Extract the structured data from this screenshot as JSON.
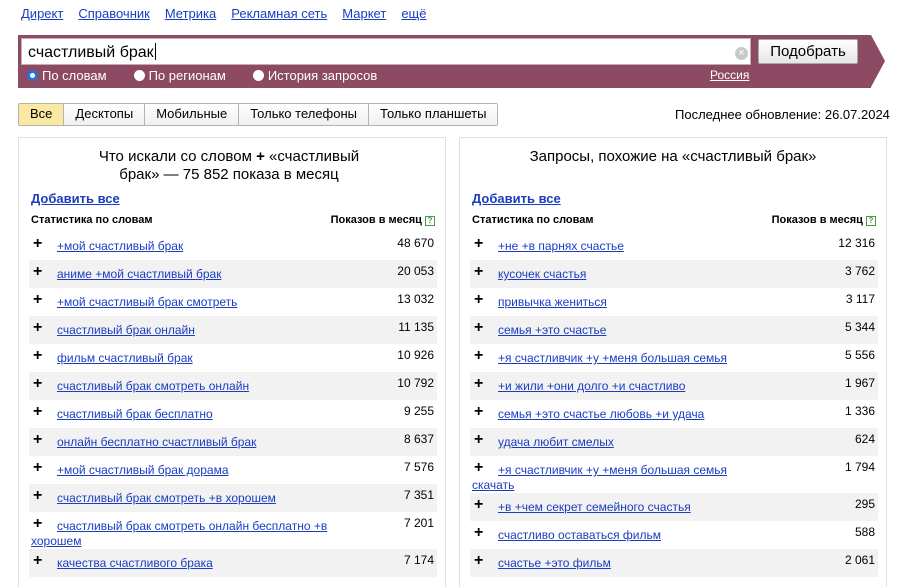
{
  "nav": [
    "Директ",
    "Справочник",
    "Метрика",
    "Рекламная сеть",
    "Маркет",
    "ещё"
  ],
  "search": {
    "query": "счастливый брак",
    "clear_glyph": "×",
    "button": "Подобрать",
    "radios": [
      "По словам",
      "По регионам",
      "История запросов"
    ],
    "region": "Россия"
  },
  "tabs": [
    "Все",
    "Десктопы",
    "Мобильные",
    "Только телефоны",
    "Только планшеты"
  ],
  "updated": "Последнее обновление: 26.07.2024",
  "left": {
    "title_line1": "Что искали со словом",
    "title_plus": "+",
    "title_rest": "«счастливый брак» — 75 852 показа в месяц",
    "add_all": "Добавить все",
    "col_phrase": "Статистика по словам",
    "col_count": "Показов в месяц",
    "rows": [
      {
        "phrase": "+мой счастливый брак",
        "count": "48 670"
      },
      {
        "phrase": "аниме +мой счастливый брак",
        "count": "20 053"
      },
      {
        "phrase": "+мой счастливый брак смотреть",
        "count": "13 032"
      },
      {
        "phrase": "счастливый брак онлайн",
        "count": "11 135"
      },
      {
        "phrase": "фильм счастливый брак",
        "count": "10 926"
      },
      {
        "phrase": "счастливый брак смотреть онлайн",
        "count": "10 792"
      },
      {
        "phrase": "счастливый брак бесплатно",
        "count": "9 255"
      },
      {
        "phrase": "онлайн бесплатно счастливый брак",
        "count": "8 637"
      },
      {
        "phrase": "+мой счастливый брак дорама",
        "count": "7 576"
      },
      {
        "phrase": "счастливый брак смотреть +в хорошем",
        "count": "7 351"
      },
      {
        "phrase": "счастливый брак смотреть онлайн бесплатно +в хорошем",
        "count": "7 201"
      },
      {
        "phrase": "качества счастливого брака",
        "count": "7 174"
      }
    ]
  },
  "right": {
    "title": "Запросы, похожие на «счастливый брак»",
    "add_all": "Добавить все",
    "col_phrase": "Статистика по словам",
    "col_count": "Показов в месяц",
    "rows": [
      {
        "phrase": "+не +в парнях счастье",
        "count": "12 316"
      },
      {
        "phrase": "кусочек счастья",
        "count": "3 762"
      },
      {
        "phrase": "привычка жениться",
        "count": "3 117"
      },
      {
        "phrase": "семья +это счастье",
        "count": "5 344"
      },
      {
        "phrase": "+я счастливчик +у +меня большая семья",
        "count": "5 556"
      },
      {
        "phrase": "+и жили +они долго +и счастливо",
        "count": "1 967"
      },
      {
        "phrase": "семья +это счастье любовь +и удача",
        "count": "1 336"
      },
      {
        "phrase": "удача любит смелых",
        "count": "624"
      },
      {
        "phrase": "+я счастливчик +у +меня большая семья скачать",
        "count": "1 794"
      },
      {
        "phrase": "+в +чем секрет семейного счастья",
        "count": "295"
      },
      {
        "phrase": "счастливо оставаться фильм",
        "count": "588"
      },
      {
        "phrase": "счастье +это фильм",
        "count": "2 061"
      }
    ]
  }
}
